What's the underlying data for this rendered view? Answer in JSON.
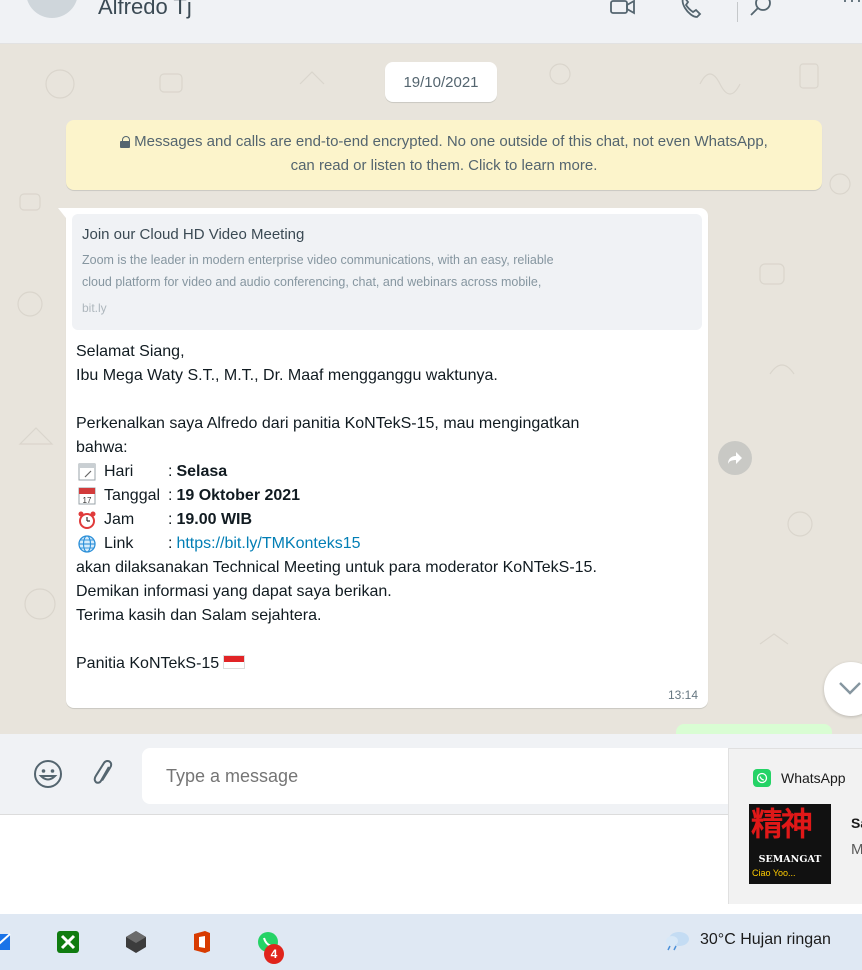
{
  "header": {
    "contact_name": "Alfredo Tj",
    "icons": [
      "video-call-icon",
      "voice-call-icon",
      "search-icon",
      "more-icon"
    ],
    "more_label": "···"
  },
  "chat": {
    "date": "19/10/2021",
    "encryption_notice": "Messages and calls are end-to-end encrypted. No one outside of this chat, not even WhatsApp, can read or listen to them. Click to learn more.",
    "encryption_line1": "Messages and calls are end-to-end encrypted. No one outside of this chat, not even WhatsApp,",
    "encryption_line2": "can read or listen to them. Click to learn more.",
    "message": {
      "preview": {
        "title": "Join our Cloud HD Video Meeting",
        "description_line1": "Zoom is the leader in modern enterprise video communications, with an easy, reliable",
        "description_line2": "cloud platform for video and audio conferencing, chat, and webinars across mobile,",
        "domain": "bit.ly"
      },
      "greeting": "Selamat Siang,",
      "line2": "Ibu Mega Waty S.T., M.T., Dr. Maaf mengganggu waktunya.",
      "intro_line1": "Perkenalkan saya Alfredo dari panitia KoNTekS-15, mau mengingatkan",
      "intro_line2": "bahwa:",
      "details": [
        {
          "icon": "calendar-icon",
          "label": "Hari",
          "value": "Selasa"
        },
        {
          "icon": "date-calendar-icon",
          "label": "Tanggal",
          "value": "19 Oktober 2021"
        },
        {
          "icon": "alarm-clock-icon",
          "label": "Jam",
          "value": "19.00 WIB"
        },
        {
          "icon": "globe-icon",
          "label": "Link",
          "value": "https://bit.ly/TMKonteks15"
        }
      ],
      "closing_line1": "akan dilaksanakan Technical Meeting untuk para moderator KoNTekS-15.",
      "closing_line2": "Demikan informasi yang dapat saya berikan.",
      "closing_line3": "Terima kasih dan Salam sejahtera.",
      "signature": "Panitia KoNTekS-15",
      "time": "13:14"
    }
  },
  "compose": {
    "placeholder": "Type a message"
  },
  "notification": {
    "app_name": "WhatsApp",
    "image_text": "精神",
    "image_caption": "SEMANGAT",
    "image_sub": "Ciao Yoo...",
    "sender": "Sa",
    "message": "M"
  },
  "taskbar": {
    "whatsapp_badge": "4",
    "weather": "30°C  Hujan ringan"
  },
  "colors": {
    "chat_bg": "#e8e4dc",
    "encryption_bg": "#fcf4cb",
    "link": "#027eb5",
    "taskbar_bg": "#dfe8f3"
  }
}
